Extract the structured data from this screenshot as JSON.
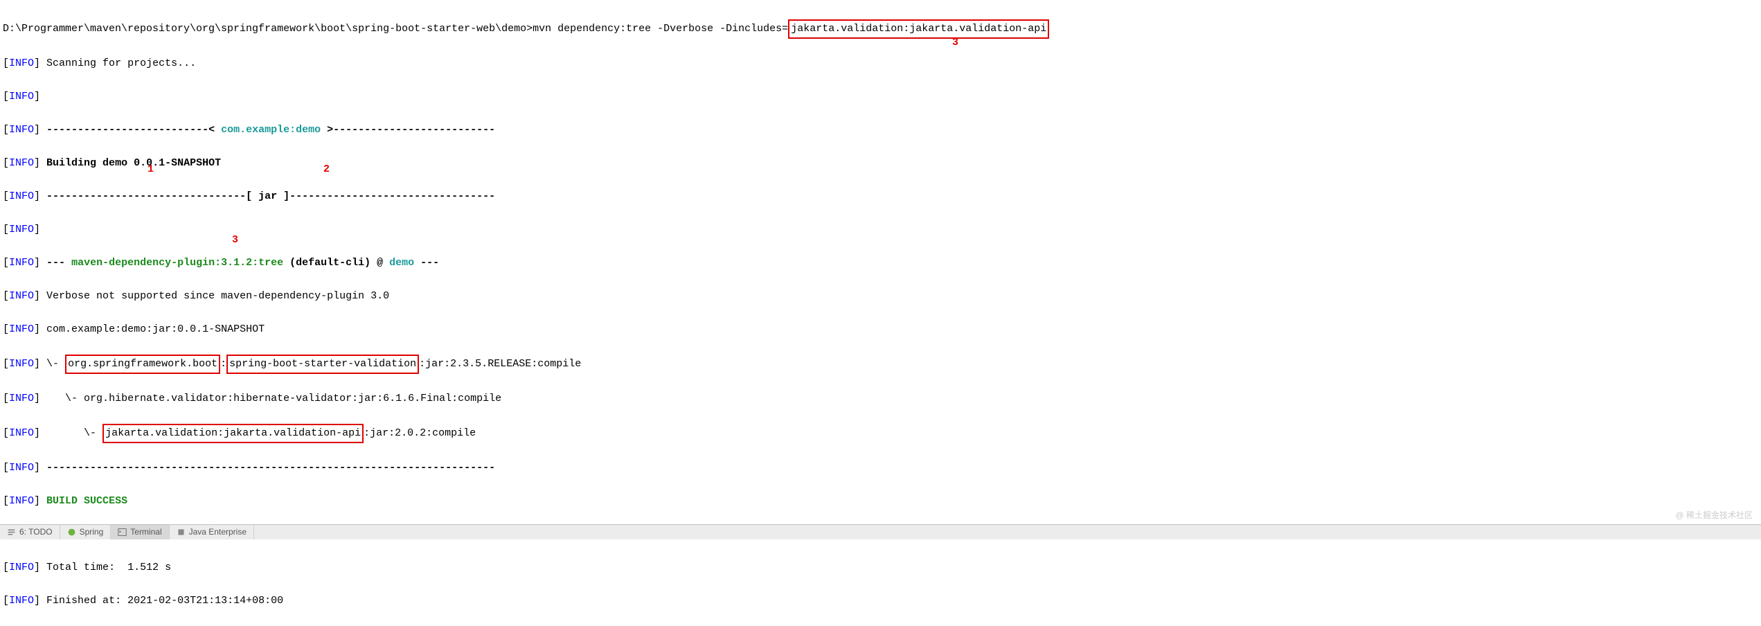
{
  "prompt": {
    "path": "D:\\Programmer\\maven\\repository\\org\\springframework\\boot\\spring-boot-starter-web\\demo>",
    "command": "mvn dependency:tree -Dverbose -Dincludes=",
    "includes_arg": "jakarta.validation:jakarta.validation-api"
  },
  "lines": {
    "scanning": "Scanning for projects...",
    "sep_open": " --------------------------< ",
    "project_coords": "com.example:demo",
    "sep_close": " >--------------------------",
    "building": "Building demo 0.0.1-SNAPSHOT",
    "jar_line": " --------------------------------[ jar ]---------------------------------",
    "plugin_pre": " --- ",
    "plugin_name": "maven-dependency-plugin:3.1.2:tree",
    "plugin_mid": " (default-cli) @ ",
    "plugin_proj": "demo",
    "plugin_post": " ---",
    "verbose": " Verbose not supported since maven-dependency-plugin 3.0",
    "root_artifact": " com.example:demo:jar:0.0.1-SNAPSHOT",
    "tree1_pre": " \\- ",
    "tree1_box1": "org.springframework.boot",
    "tree1_mid": ":",
    "tree1_box2": "spring-boot-starter-validation",
    "tree1_post": ":jar:2.3.5.RELEASE:compile",
    "tree2": "    \\- org.hibernate.validator:hibernate-validator:jar:6.1.6.Final:compile",
    "tree3_pre": "       \\- ",
    "tree3_box": "jakarta.validation:jakarta.validation-api",
    "tree3_post": ":jar:2.0.2:compile",
    "dash72": " ------------------------------------------------------------------------",
    "build_success": " BUILD SUCCESS",
    "total_time": " Total time:  1.512 s",
    "finished_at": " Finished at: 2021-02-03T21:13:14+08:00"
  },
  "annotations": {
    "a1": "1",
    "a2": "2",
    "a3": "3"
  },
  "status_bar": {
    "todo": "6: TODO",
    "spring": "Spring",
    "terminal": "Terminal",
    "java_enterprise": "Java Enterprise"
  },
  "watermark": "@ 稀土掘金技术社区"
}
